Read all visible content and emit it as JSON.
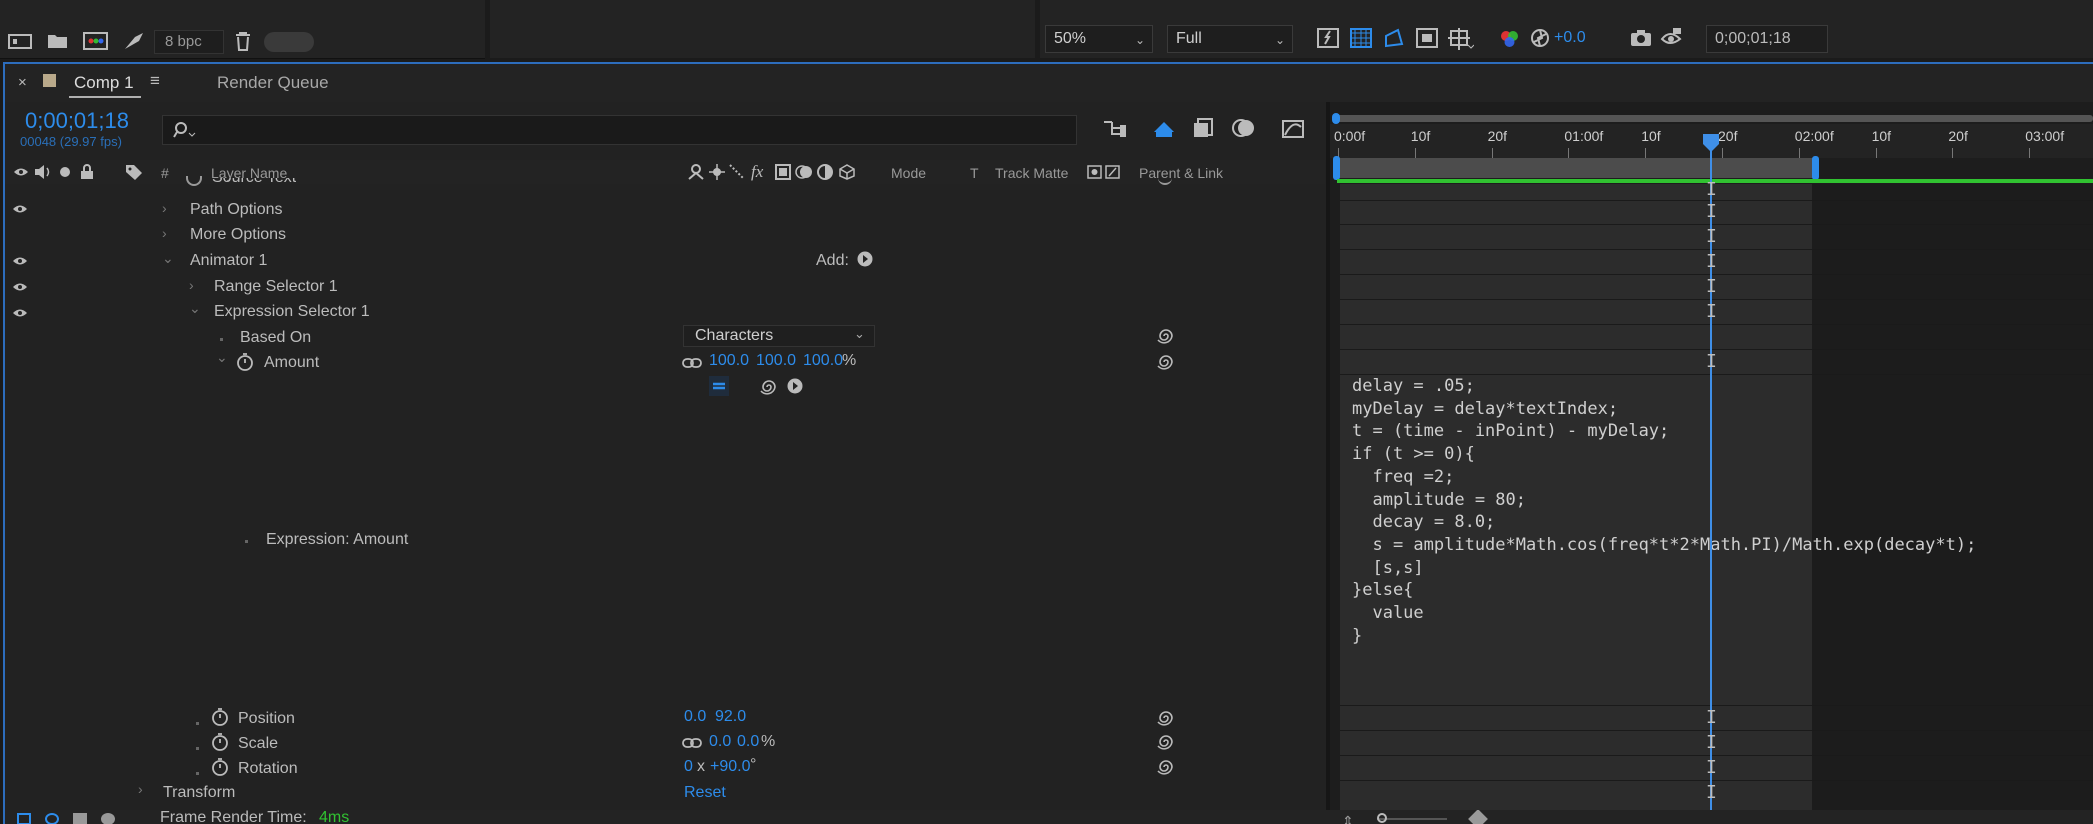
{
  "toolbar": {
    "bpc": "8 bpc",
    "zoom": "50%",
    "resolution": "Full",
    "exposure": "+0.0",
    "timecode": "0;00;01;18"
  },
  "tabs": {
    "comp": "Comp 1",
    "render_queue": "Render Queue"
  },
  "time": {
    "current": "0;00;01;18",
    "frames": "00048 (29.97 fps)"
  },
  "columns": {
    "hash": "#",
    "layer_name": "Layer Name",
    "fx": "fx",
    "mode": "Mode",
    "t": "T",
    "track_matte": "Track Matte",
    "parent_link": "Parent & Link"
  },
  "layers": {
    "source_text": "Source Text",
    "path_options": "Path Options",
    "more_options": "More Options",
    "animator": "Animator 1",
    "add": "Add:",
    "range_selector": "Range Selector 1",
    "expression_selector": "Expression Selector 1",
    "based_on": "Based On",
    "based_on_value": "Characters",
    "amount": "Amount",
    "amount_x": "100.0",
    "amount_y": "100.0",
    "amount_z": "100.0",
    "percent": "%",
    "expression_label": "Expression: Amount",
    "position": "Position",
    "position_x": "0.0",
    "position_y": "92.0",
    "scale": "Scale",
    "scale_x": "0.0",
    "scale_y": "0.0",
    "rotation": "Rotation",
    "rotation_rev": "0",
    "rotation_x": "x",
    "rotation_deg": "+90.0",
    "degree": "°",
    "transform": "Transform",
    "reset": "Reset"
  },
  "ruler": {
    "labels": [
      "0:00f",
      "10f",
      "20f",
      "01:00f",
      "10f",
      "20f",
      "02:00f",
      "10f",
      "20f",
      "03:00f"
    ]
  },
  "expression": {
    "code": "delay = .05;\nmyDelay = delay*textIndex;\nt = (time - inPoint) - myDelay;\nif (t >= 0){\n  freq =2;\n  amplitude = 80;\n  decay = 8.0;\n  s = amplitude*Math.cos(freq*t*2*Math.PI)/Math.exp(decay*t);\n  [s,s]\n}else{\n  value\n}"
  },
  "status": {
    "frame_render_label": "Frame Render Time:",
    "frame_render_value": "4ms"
  },
  "colors": {
    "accent": "#2d8ceb",
    "green_bar": "#31c231",
    "panel_border": "#2d6dbd"
  }
}
